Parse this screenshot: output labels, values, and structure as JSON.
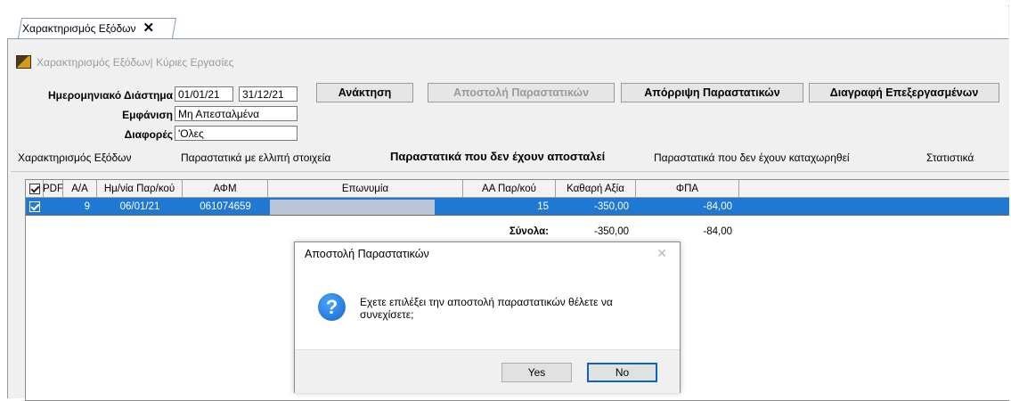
{
  "window_tab": {
    "label": "Χαρακτηρισμός Εξόδων",
    "close": "✕"
  },
  "breadcrumb": "Χαρακτηρισμός Εξόδων| Κύριες Εργασίες",
  "filters": {
    "period_label": "Ημερομηνιακό Διάστημα",
    "date_from": "01/01/21",
    "date_to": "31/12/21",
    "display_label": "Εμφάνιση",
    "display_value": "Μη Απεσταλμένα",
    "diff_label": "Διαφορές",
    "diff_value": "'Ολες"
  },
  "buttons": {
    "retrieve": "Ανάκτηση",
    "send": "Αποστολή Παραστατικών",
    "reject": "Απόρριψη Παραστατικών",
    "delete_processed": "Διαγραφή Επεξεργασμένων"
  },
  "tabs": [
    "Χαρακτηρισμός Εξόδων",
    "Παραστατικά με ελλιπή στοιχεία",
    "Παραστατικά που δεν έχουν αποσταλεί",
    "Παραστατικά που δεν έχουν καταχωρηθεί",
    "Στατιστικά"
  ],
  "grid": {
    "columns": [
      "PDF",
      "Α/Α",
      "Ημ/νία Παρ/κού",
      "ΑΦΜ",
      "Επωνυμία",
      "ΑΑ Παρ/κού",
      "Καθαρή Αξία",
      "ΦΠΑ"
    ],
    "row": {
      "aa": "9",
      "date": "06/01/21",
      "afm": "061074659",
      "doc_no": "15",
      "net": "-350,00",
      "vat": "-84,00"
    },
    "totals": {
      "label": "Σύνολα:",
      "net": "-350,00",
      "vat": "-84,00"
    }
  },
  "dialog": {
    "title": "Αποστολή Παραστατικών",
    "close": "✕",
    "icon": "?",
    "message": "Εχετε επιλέξει την αποστολή παραστατικών θέλετε να συνεχίσετε;",
    "yes": "Yes",
    "no": "No"
  },
  "colors": {
    "selection": "#1f78d1",
    "accent": "#0a64c8"
  }
}
